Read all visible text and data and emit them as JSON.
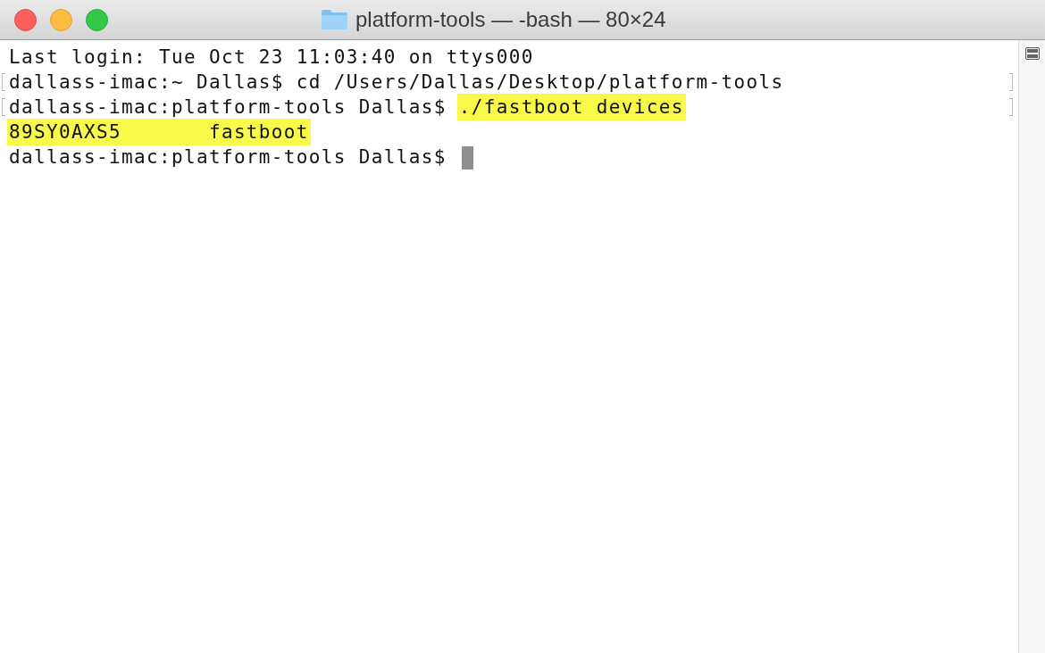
{
  "window": {
    "title": "platform-tools — -bash — 80×24"
  },
  "lines": [
    {
      "marked": false,
      "cursor": false,
      "segments": [
        {
          "text": "Last login: Tue Oct 23 11:03:40 on ttys000",
          "highlighted": false
        }
      ]
    },
    {
      "marked": true,
      "cursor": false,
      "segments": [
        {
          "text": "dallass-imac:~ Dallas$ cd /Users/Dallas/Desktop/platform-tools",
          "highlighted": false
        }
      ]
    },
    {
      "marked": true,
      "cursor": false,
      "segments": [
        {
          "text": "dallass-imac:platform-tools Dallas$ ",
          "highlighted": false
        },
        {
          "text": "./fastboot devices",
          "highlighted": true
        }
      ]
    },
    {
      "marked": false,
      "cursor": false,
      "segments": [
        {
          "text": "89SY0AXS5       fastboot",
          "highlighted": true
        }
      ]
    },
    {
      "marked": false,
      "cursor": true,
      "segments": [
        {
          "text": "dallass-imac:platform-tools Dallas$ ",
          "highlighted": false
        }
      ]
    }
  ]
}
